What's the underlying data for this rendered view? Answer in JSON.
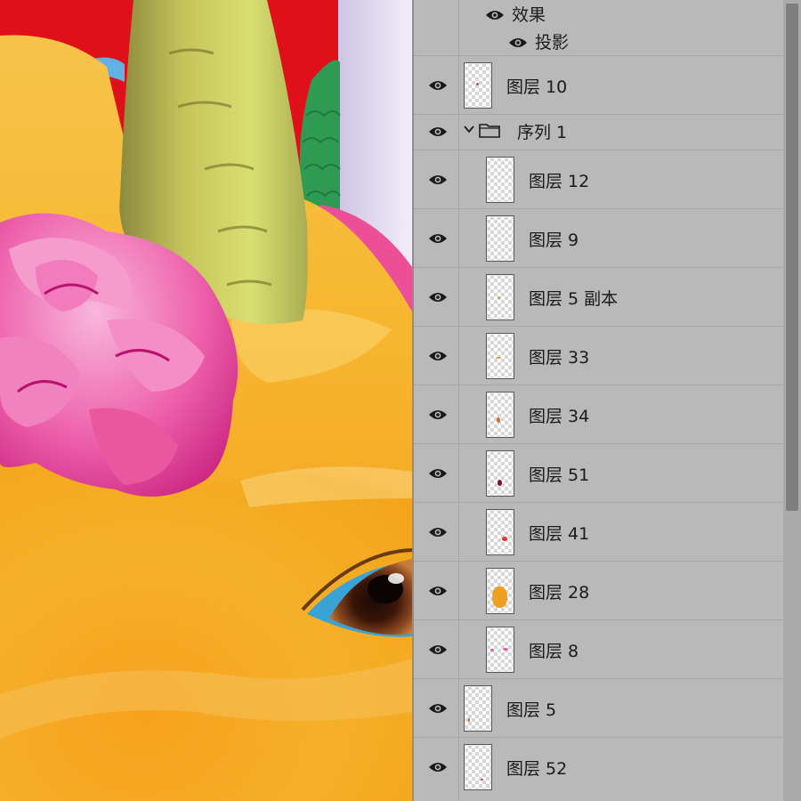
{
  "canvas": {
    "subject": "orange-ox-with-pink-flower"
  },
  "layers_panel": {
    "effects_label": "效果",
    "shadow_label": "投影",
    "group": {
      "name": "序列 1",
      "expanded": true
    },
    "top_layer": {
      "name": "图层 10"
    },
    "group_layers": [
      {
        "name": "图层 12"
      },
      {
        "name": "图层 9"
      },
      {
        "name": "图层 5 副本"
      },
      {
        "name": "图层 33"
      },
      {
        "name": "图层 34"
      },
      {
        "name": "图层 51"
      },
      {
        "name": "图层 41"
      },
      {
        "name": "图层 28"
      },
      {
        "name": "图层 8"
      }
    ],
    "bottom_layers": [
      {
        "name": "图层 5"
      },
      {
        "name": "图层 52"
      }
    ],
    "icons": {
      "visibility": "eye-icon",
      "expand": "chevron-down-icon",
      "group": "folder-icon"
    }
  }
}
